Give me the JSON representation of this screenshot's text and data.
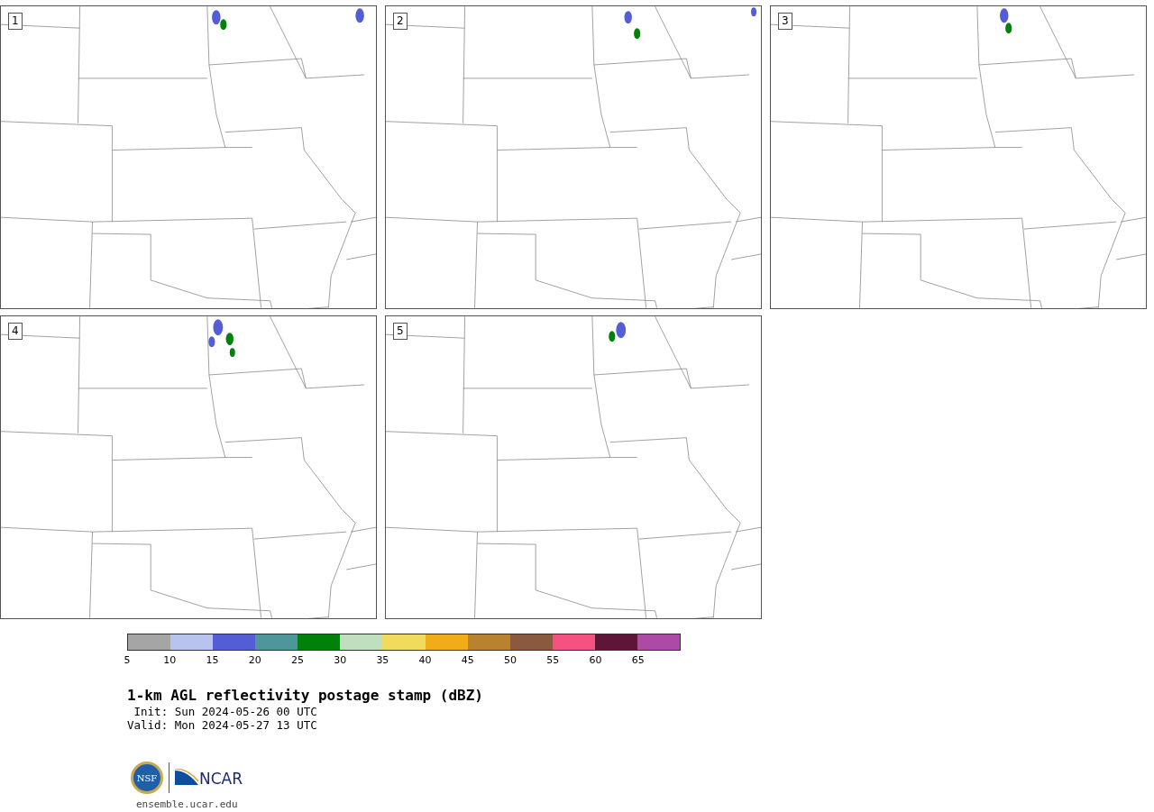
{
  "panels": [
    {
      "label": "1"
    },
    {
      "label": "2"
    },
    {
      "label": "3"
    },
    {
      "label": "4"
    },
    {
      "label": "5"
    }
  ],
  "colorbar": {
    "segments": [
      {
        "color": "#a5a5a5"
      },
      {
        "color": "#b8c3ee"
      },
      {
        "color": "#525dd6"
      },
      {
        "color": "#4f959c"
      },
      {
        "color": "#00820a"
      },
      {
        "color": "#bfdfbf"
      },
      {
        "color": "#f0db5c"
      },
      {
        "color": "#f0ad17"
      },
      {
        "color": "#b8822f"
      },
      {
        "color": "#8a5a3e"
      },
      {
        "color": "#f55181"
      },
      {
        "color": "#5e1537"
      },
      {
        "color": "#ad4aa5"
      }
    ],
    "ticks": [
      "5",
      "10",
      "15",
      "20",
      "25",
      "30",
      "35",
      "40",
      "45",
      "50",
      "55",
      "60",
      "65"
    ]
  },
  "title": "1-km AGL reflectivity postage stamp (dBZ)",
  "init": " Init: Sun 2024-05-26 00 UTC",
  "valid": "Valid: Mon 2024-05-27 13 UTC",
  "logos": {
    "nsf": "NSF",
    "ncar": "NCAR"
  },
  "url": "ensemble.ucar.edu"
}
